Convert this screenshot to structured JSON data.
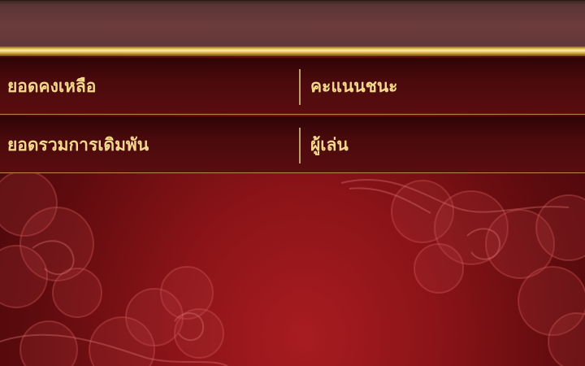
{
  "rows": [
    {
      "label": "ยอดคงเหลือ",
      "value": "คะแนนชนะ"
    },
    {
      "label": "ยอดรวมการเดิมพัน",
      "value": "ผู้เล่น"
    }
  ]
}
